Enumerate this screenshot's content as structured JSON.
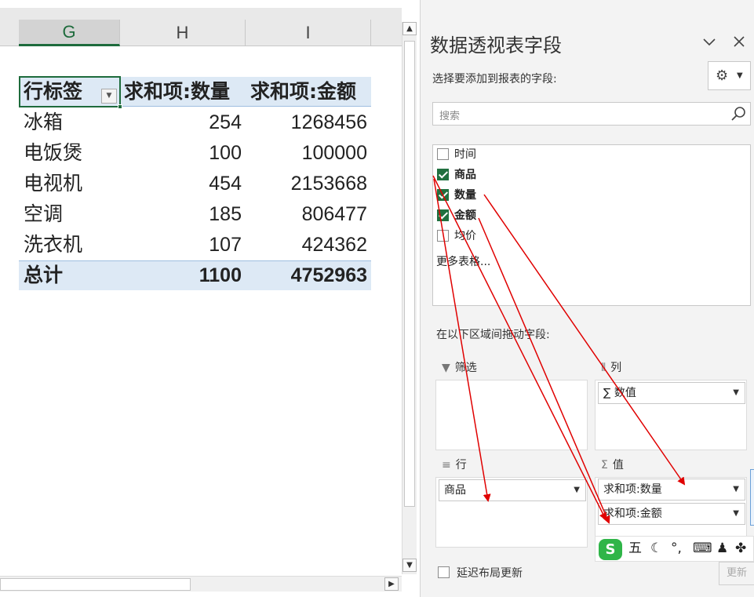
{
  "sheet": {
    "columns": [
      "G",
      "H",
      "I"
    ],
    "pivot": {
      "header": {
        "row_label": "行标签",
        "sum_qty": "求和项:数量",
        "sum_amount": "求和项:金额"
      },
      "rows": [
        {
          "label": "冰箱",
          "qty": "254",
          "amount": "1268456"
        },
        {
          "label": "电饭煲",
          "qty": "100",
          "amount": "100000"
        },
        {
          "label": "电视机",
          "qty": "454",
          "amount": "2153668"
        },
        {
          "label": "空调",
          "qty": "185",
          "amount": "806477"
        },
        {
          "label": "洗衣机",
          "qty": "107",
          "amount": "424362"
        }
      ],
      "total": {
        "label": "总计",
        "qty": "1100",
        "amount": "4752963"
      }
    },
    "icons": {
      "dropdown": "filter-dropdown-icon"
    }
  },
  "pane": {
    "title": "数据透视表字段",
    "subtitle": "选择要添加到报表的字段:",
    "search_placeholder": "搜索",
    "fields": [
      {
        "label": "时间",
        "checked": false
      },
      {
        "label": "商品",
        "checked": true
      },
      {
        "label": "数量",
        "checked": true
      },
      {
        "label": "金额",
        "checked": true
      },
      {
        "label": "均价",
        "checked": false
      }
    ],
    "more_tables": "更多表格...",
    "drag_hint": "在以下区域间拖动字段:",
    "areas": {
      "filter": {
        "label": "筛选",
        "items": []
      },
      "columns": {
        "label": "列",
        "items": [
          "数值"
        ]
      },
      "rows": {
        "label": "行",
        "items": [
          "商品"
        ]
      },
      "values": {
        "label": "值",
        "items": [
          "求和项:数量",
          "求和项:金额"
        ]
      }
    },
    "defer_label": "延迟布局更新",
    "update_label": "更新"
  },
  "ime": {
    "logo": "S",
    "mode": "五",
    "items": [
      "moon-icon",
      "punctuation-icon",
      "keyboard-icon",
      "user-icon",
      "grid-icon"
    ]
  },
  "colors": {
    "excel_green": "#21703f",
    "pivot_header_bg": "#dde9f5",
    "arrow_red": "#e00000",
    "ime_green": "#2fb548"
  }
}
